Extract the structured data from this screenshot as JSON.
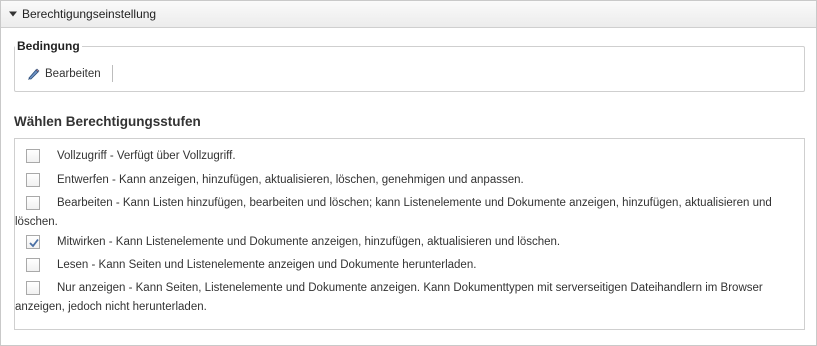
{
  "header": {
    "title": "Berechtigungseinstellung",
    "caret_icon": "triangle-down-icon"
  },
  "condition": {
    "legend": "Bedingung",
    "edit_label": "Bearbeiten",
    "edit_icon": "pencil-icon"
  },
  "levels": {
    "title": "Wählen Berechtigungsstufen",
    "options": [
      {
        "label": "Vollzugriff - Verfügt über Vollzugriff.",
        "checked": false
      },
      {
        "label": "Entwerfen - Kann anzeigen, hinzufügen, aktualisieren, löschen, genehmigen und anpassen.",
        "checked": false
      },
      {
        "label": "Bearbeiten - Kann Listen hinzufügen, bearbeiten und löschen; kann Listenelemente und Dokumente anzeigen, hinzufügen, aktualisieren und löschen.",
        "checked": false
      },
      {
        "label": "Mitwirken - Kann Listenelemente und Dokumente anzeigen, hinzufügen, aktualisieren und löschen.",
        "checked": true
      },
      {
        "label": "Lesen - Kann Seiten und Listenelemente anzeigen und Dokumente herunterladen.",
        "checked": false
      },
      {
        "label": "Nur anzeigen - Kann Seiten, Listenelemente und Dokumente anzeigen. Kann Dokumenttypen mit serverseitigen Dateihandlern im Browser anzeigen, jedoch nicht herunterladen.",
        "checked": false
      }
    ]
  },
  "colors": {
    "check": "#4a6fa5",
    "border": "#cfcfcf"
  }
}
